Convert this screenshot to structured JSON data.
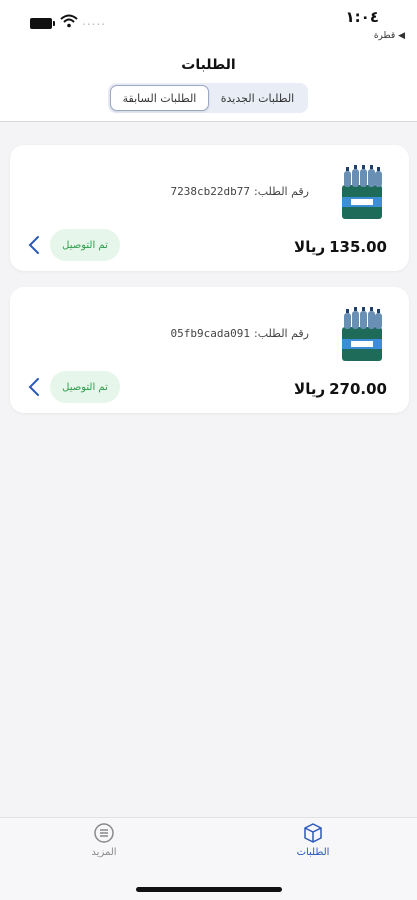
{
  "status_bar": {
    "time": "١:٠٤",
    "back_label": "◀ قطرة",
    "signal_dots": "....."
  },
  "header": {
    "title": "الطلبات",
    "tabs": [
      {
        "label": "الطلبات الجديدة",
        "selected": false
      },
      {
        "label": "الطلبات السابقة",
        "selected": true
      }
    ]
  },
  "orders": [
    {
      "order_label": "رقم الطلب:",
      "order_id": "7238cb22db77",
      "amount": "135.00",
      "currency": "ريالا",
      "status": "تم التوصيل",
      "thumbnail": "water-pack-image"
    },
    {
      "order_label": "رقم الطلب:",
      "order_id": "05fb9cada091",
      "amount": "270.00",
      "currency": "ريالا",
      "status": "تم التوصيل",
      "thumbnail": "water-pack-image"
    }
  ],
  "tab_bar": {
    "orders_label": "الطلبات",
    "orders_icon": "box-icon",
    "more_label": "المزيد",
    "more_icon": "menu-circle-icon",
    "active_color": "#2b58b8",
    "inactive_color": "#8a8a8a"
  },
  "colors": {
    "delivered_badge_bg": "#e6f6ea",
    "delivered_text": "#2e9d4c",
    "chevron": "#2b58b8"
  }
}
